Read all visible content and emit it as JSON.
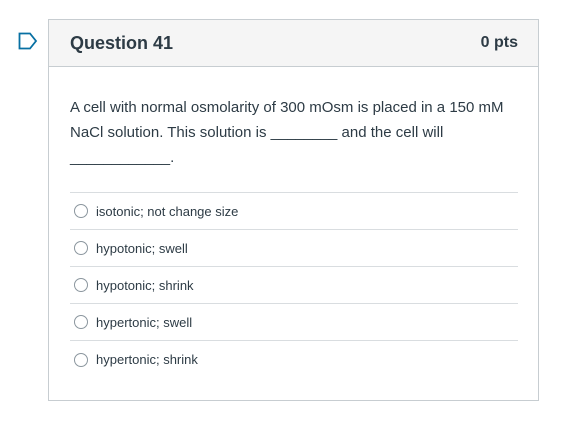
{
  "question": {
    "title": "Question 41",
    "points": "0 pts",
    "text": "A cell with normal osmolarity of 300 mOsm is placed in a 150 mM NaCl solution. This solution is ________ and the cell will ____________.",
    "answers": [
      {
        "label": "isotonic; not change size"
      },
      {
        "label": "hypotonic; swell"
      },
      {
        "label": "hypotonic; shrink"
      },
      {
        "label": "hypertonic; swell"
      },
      {
        "label": "hypertonic; shrink"
      }
    ]
  },
  "colors": {
    "flag": "#0770a3",
    "text": "#2d3b45",
    "border": "#c7cdd1",
    "header_bg": "#f5f5f5"
  },
  "icons": {
    "flag": "flag-question-icon",
    "radio": "radio-button-icon"
  }
}
